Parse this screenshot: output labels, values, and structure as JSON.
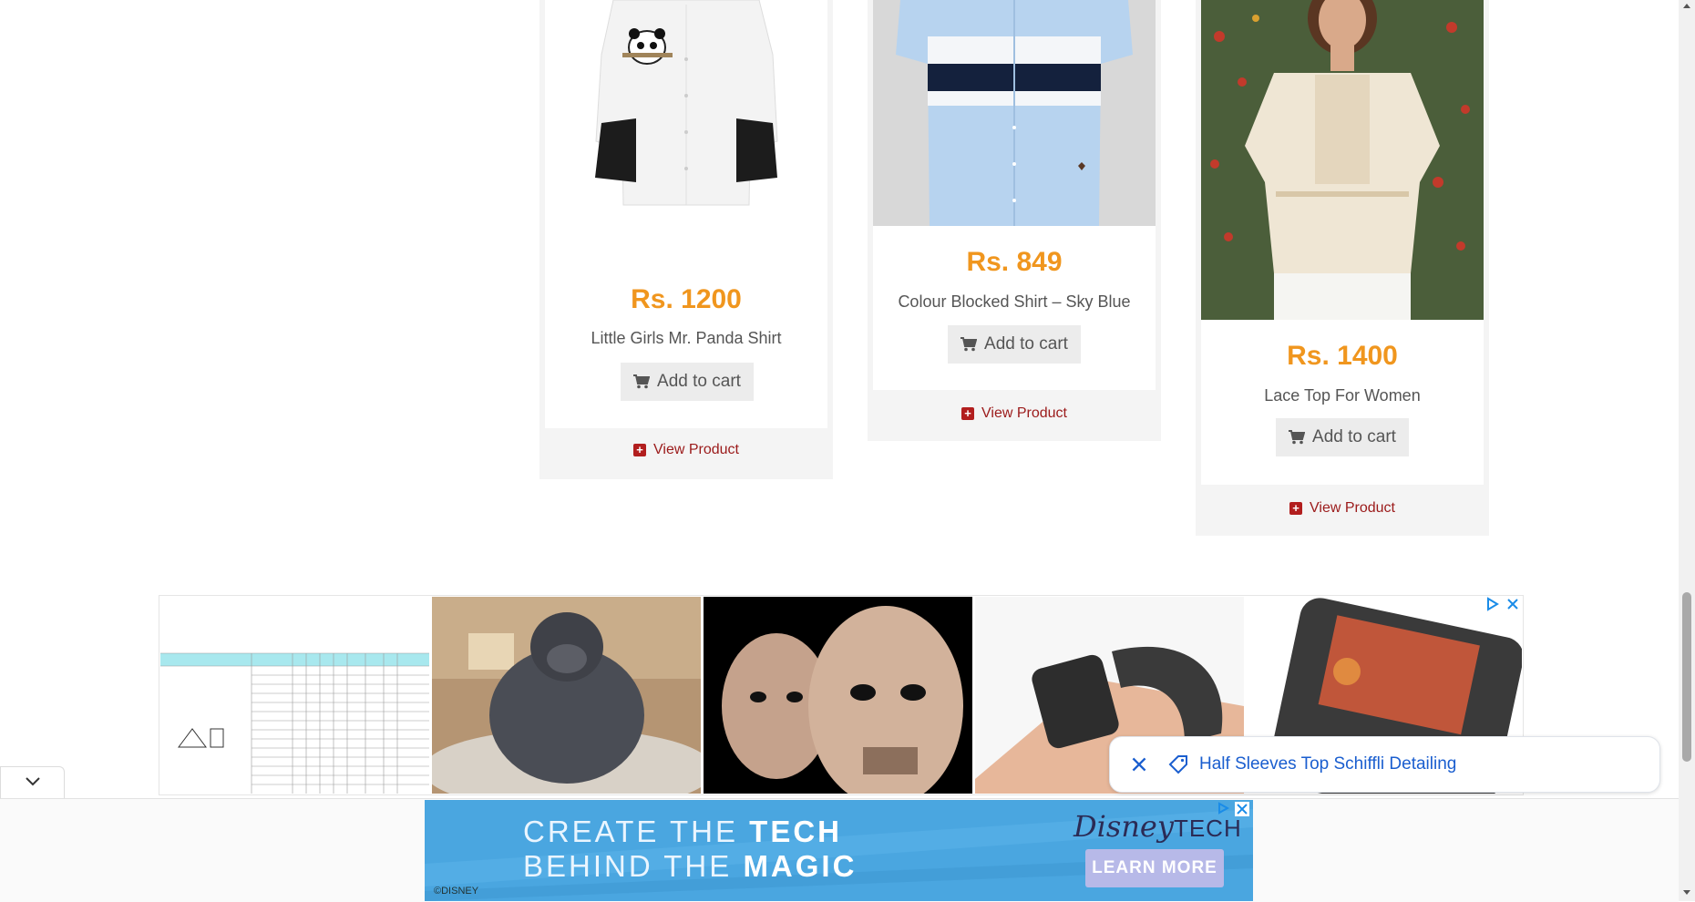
{
  "products": [
    {
      "price": "Rs. 1200",
      "name": "Little Girls Mr. Panda Shirt",
      "cart_label": "Add to cart",
      "view_label": "View Product"
    },
    {
      "price": "Rs. 849",
      "name": "Colour Blocked Shirt – Sky Blue",
      "cart_label": "Add to cart",
      "view_label": "View Product"
    },
    {
      "price": "Rs. 1400",
      "name": "Lace Top For Women",
      "cart_label": "Add to cart",
      "view_label": "View Product"
    }
  ],
  "suggestion_pill": {
    "text": "Half Sleeves Top Schiffli Detailing"
  },
  "bottom_banner": {
    "line1_a": "CREATE THE ",
    "line1_b": "TECH",
    "line2_a": "BEHIND THE ",
    "line2_b": "MAGIC",
    "logo_main": "Disney",
    "logo_suffix": "TECH",
    "button": "LEARN MORE",
    "copyright": "©DISNEY"
  },
  "colors": {
    "price": "#f0961e",
    "view_link": "#9b1a1a",
    "pill_text": "#1a5ecf",
    "banner_bg": "#4aa3df"
  }
}
